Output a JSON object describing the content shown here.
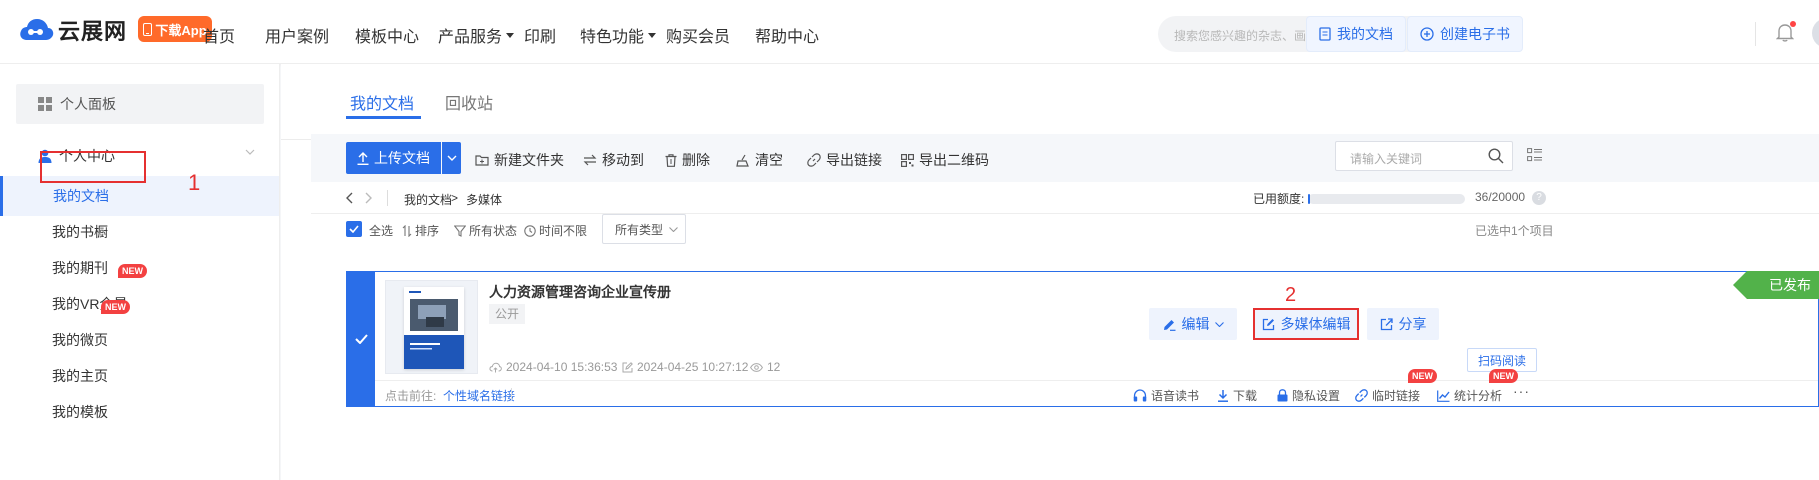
{
  "header": {
    "brand": "云展网",
    "app_badge": "下载App",
    "nav": [
      {
        "label": "首页"
      },
      {
        "label": "用户案例"
      },
      {
        "label": "模板中心"
      },
      {
        "label": "产品服务"
      },
      {
        "label": "印刷"
      },
      {
        "label": "特色功能"
      },
      {
        "label": "购买会员"
      },
      {
        "label": "帮助中心"
      }
    ],
    "search_placeholder": "搜索您感兴趣的杂志、画册、文档",
    "my_docs_button": "我的文档",
    "create_ebook_button": "创建电子书"
  },
  "sidebar": {
    "panel_label": "个人面板",
    "group_label": "个人中心",
    "items": [
      {
        "label": "我的文档"
      },
      {
        "label": "我的书橱"
      },
      {
        "label": "我的期刊"
      },
      {
        "label": "我的VR全景"
      },
      {
        "label": "我的微页"
      },
      {
        "label": "我的主页"
      },
      {
        "label": "我的模板"
      }
    ],
    "new_badge": "NEW",
    "step_1": "1"
  },
  "main": {
    "tabs": [
      {
        "label": "我的文档"
      },
      {
        "label": "回收站"
      }
    ],
    "toolbar": {
      "upload": "上传文档",
      "new_folder": "新建文件夹",
      "move_to": "移动到",
      "delete": "删除",
      "clear": "清空",
      "export_link": "导出链接",
      "export_qr": "导出二维码",
      "keyword_placeholder": "请输入关键词"
    },
    "breadcrumb": {
      "root": "我的文档",
      "separator": ">",
      "current": "多媒体"
    },
    "quota": {
      "label": "已用额度:",
      "text": "36/20000",
      "used_fraction": 0.0018
    },
    "filters": {
      "select_all": "全选",
      "sort": "排序",
      "status": "所有状态",
      "time": "时间不限",
      "type": "所有类型",
      "selected_count": "已选中1个项目"
    },
    "doc": {
      "title": "人力资源管理咨询企业宣传册",
      "visibility": "公开",
      "created": "2024-04-10 15:36:53",
      "modified": "2024-04-25 10:27:12",
      "views": "12",
      "status": "已发布",
      "edit": "编辑",
      "media_edit": "多媒体编辑",
      "share": "分享",
      "scan_read": "扫码阅读",
      "goto_label": "点击前往:",
      "domain_link": "个性域名链接",
      "foot_tools": {
        "voice": "语音读书",
        "download": "下载",
        "privacy": "隐私设置",
        "temp_link": "临时链接",
        "stats": "统计分析"
      },
      "new_badge": "NEW",
      "step_2": "2"
    }
  },
  "colors": {
    "accent": "#2a6ee8",
    "highlight": "#e53030",
    "published": "#52b24a",
    "new_badge": "#f34141",
    "app_badge": "#ff6a2a"
  }
}
